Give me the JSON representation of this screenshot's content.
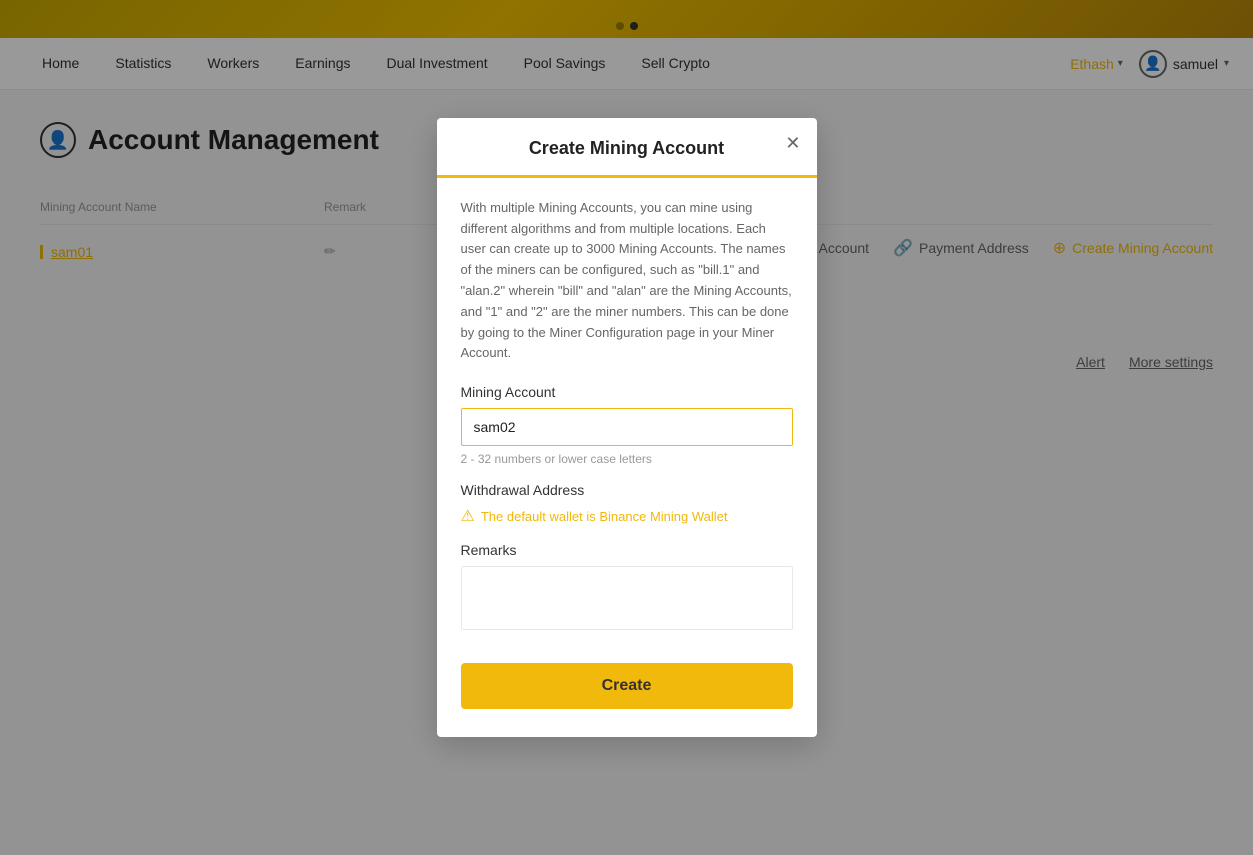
{
  "banner": {
    "dots": [
      "inactive",
      "active"
    ]
  },
  "navbar": {
    "items": [
      {
        "label": "Home",
        "active": false
      },
      {
        "label": "Statistics",
        "active": false
      },
      {
        "label": "Workers",
        "active": false
      },
      {
        "label": "Earnings",
        "active": false
      },
      {
        "label": "Dual Investment",
        "active": false
      },
      {
        "label": "Pool Savings",
        "active": false
      },
      {
        "label": "Sell Crypto",
        "active": false
      }
    ],
    "algo": "Ethash",
    "username": "samuel"
  },
  "page": {
    "title": "Account Management",
    "action_bar": {
      "sub_account": "Sub Account",
      "payment_address": "Payment Address",
      "create_mining_account": "Create Mining Account"
    },
    "table": {
      "col_name": "Mining Account Name",
      "col_remark": "Remark",
      "rows": [
        {
          "name": "sam01",
          "remark": ""
        }
      ]
    },
    "right_links": {
      "alert": "Alert",
      "more_settings": "More settings"
    }
  },
  "modal": {
    "title": "Create Mining Account",
    "description": "With multiple Mining Accounts, you can mine using different algorithms and from multiple locations. Each user can create up to 3000 Mining Accounts. The names of the miners can be configured, such as \"bill.1\" and \"alan.2\" wherein \"bill\" and \"alan\" are the Mining Accounts, and \"1\" and \"2\" are the miner numbers. This can be done by going to the Miner Configuration page in your Miner Account.",
    "mining_account_label": "Mining Account",
    "mining_account_value": "sam02",
    "mining_account_hint": "2 - 32 numbers or lower case letters",
    "withdrawal_label": "Withdrawal Address",
    "withdrawal_warning": "The default wallet is Binance Mining Wallet",
    "remarks_label": "Remarks",
    "create_button": "Create"
  }
}
